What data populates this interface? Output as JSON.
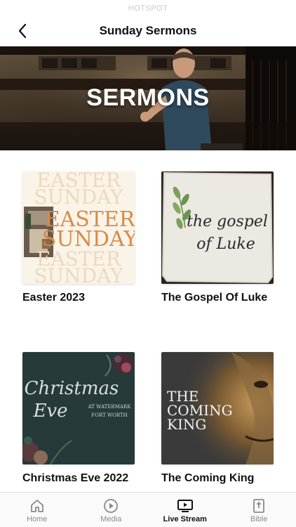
{
  "status_bar": {
    "text": "HOTSPOT"
  },
  "nav": {
    "title": "Sunday Sermons"
  },
  "hero": {
    "title": "SERMONS"
  },
  "cards": [
    {
      "title": "Easter 2023",
      "art_lines": [
        "EASTER",
        "SUNDAY",
        "EASTER",
        "SUNDAY",
        "EASTER",
        "SUNDAY"
      ]
    },
    {
      "title": "The Gospel Of Luke",
      "art_lines": [
        "the gospel",
        "of Luke"
      ]
    },
    {
      "title": "Christmas Eve 2022",
      "art_lines": [
        "Christmas",
        "Eve",
        "AT WATERMARK",
        "FORT WORTH"
      ]
    },
    {
      "title": "The Coming King",
      "art_lines": [
        "THE",
        "COMING",
        "KING"
      ]
    }
  ],
  "tabs": [
    {
      "label": "Home",
      "icon": "home-icon",
      "active": false
    },
    {
      "label": "Media",
      "icon": "play-circle-icon",
      "active": false
    },
    {
      "label": "Live Stream",
      "icon": "tv-play-icon",
      "active": true
    },
    {
      "label": "Bible",
      "icon": "bible-cross-icon",
      "active": false
    }
  ],
  "colors": {
    "accent_orange": "#d98a4a",
    "christmas_bg": "#263a3a",
    "king_bg": "#3a3a3a"
  }
}
